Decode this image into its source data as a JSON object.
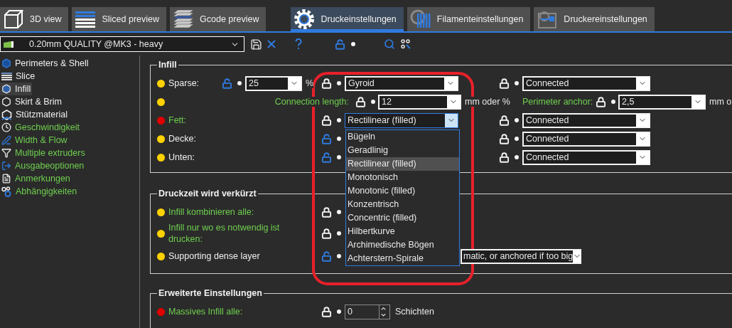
{
  "tabs": [
    {
      "label": "3D view",
      "kind": "view",
      "selected": false
    },
    {
      "label": "Sliced preview",
      "kind": "view",
      "selected": false
    },
    {
      "label": "Gcode preview",
      "kind": "view",
      "selected": false
    },
    {
      "label": "Druckeinstellungen",
      "kind": "settings",
      "selected": true
    },
    {
      "label": "Filamenteinstellungen",
      "kind": "settings",
      "selected": false
    },
    {
      "label": "Druckereinstellungen",
      "kind": "settings",
      "selected": false
    }
  ],
  "preset": {
    "value": "0.20mm QUALITY @MK3 - heavy",
    "locked": false
  },
  "sidebar": [
    {
      "label": "Perimeters & Shell",
      "system_value": false,
      "selected": false
    },
    {
      "label": "Slice",
      "system_value": false,
      "selected": false
    },
    {
      "label": "Infill",
      "system_value": false,
      "selected": true
    },
    {
      "label": "Skirt & Brim",
      "system_value": false,
      "selected": false
    },
    {
      "label": "Stützmaterial",
      "system_value": false,
      "selected": false
    },
    {
      "label": "Geschwindigkeit",
      "system_value": true,
      "selected": false
    },
    {
      "label": "Width & Flow",
      "system_value": true,
      "selected": false
    },
    {
      "label": "Multiple extruders",
      "system_value": true,
      "selected": false
    },
    {
      "label": "Ausgabeoptionen",
      "system_value": true,
      "selected": false
    },
    {
      "label": "Anmerkungen",
      "system_value": true,
      "selected": false
    },
    {
      "label": "Abhängigkeiten",
      "system_value": true,
      "selected": false
    }
  ],
  "infill": {
    "title": "Infill",
    "rows": [
      {
        "kind": "setting",
        "color": "#ffd200",
        "label": "Sparse:",
        "system_value": false,
        "lock_a": {
          "locked": false
        },
        "value_a": "25",
        "unit_a": "%",
        "lock_b": {
          "locked": true
        },
        "value_b": {
          "value": "Gyroid",
          "open": false
        },
        "lock_c": {
          "locked": true
        },
        "value_c": "Connected"
      },
      {
        "kind": "connection",
        "color": "#ffd200",
        "label": "Connection length:",
        "lock": {
          "locked": true
        },
        "value": "12",
        "unit": "mm oder %",
        "label_2": "Perimeter anchor:",
        "lock_2": {
          "locked": true
        },
        "value_2": "2,5",
        "unit_2": "mm o"
      },
      {
        "kind": "setting",
        "color": "#e00000",
        "label": "Fett:",
        "system_value": true,
        "lock_b": {
          "locked": true
        },
        "value_b": {
          "value": "Rectilinear (filled)",
          "open": true
        },
        "lock_c": {
          "locked": true
        },
        "value_c": "Connected"
      },
      {
        "kind": "setting",
        "color": "#ffd200",
        "label": "Decke:",
        "system_value": false,
        "lock_b": {
          "locked": false
        },
        "lock_c": {
          "locked": true
        },
        "value_c": "Connected"
      },
      {
        "kind": "setting",
        "color": "#ffd200",
        "label": "Unten:",
        "system_value": false,
        "lock_b": {
          "locked": false
        },
        "lock_c": {
          "locked": true
        },
        "value_c": "Connected"
      }
    ]
  },
  "dropdown": {
    "items": [
      {
        "label": "Bügeln",
        "selected": false
      },
      {
        "label": "Geradlinig",
        "selected": false
      },
      {
        "label": "Rectilinear (filled)",
        "selected": true
      },
      {
        "label": "Monotonisch",
        "selected": false
      },
      {
        "label": "Monotonic (filled)",
        "selected": false
      },
      {
        "label": "Konzentrisch",
        "selected": false
      },
      {
        "label": "Concentric (filled)",
        "selected": false
      },
      {
        "label": "Hilbertkurve",
        "selected": false
      },
      {
        "label": "Archimedische Bögen",
        "selected": false
      },
      {
        "label": "Achterstern-Spirale",
        "selected": false
      }
    ]
  },
  "reduce_time": {
    "title": "Druckzeit wird verkürzt",
    "rows": [
      {
        "color": "#ffd200",
        "label": "Infill kombinieren alle:",
        "system_value": true,
        "lock": {
          "locked": true
        }
      },
      {
        "color": "#ffd200",
        "label": "Infill nur wo es notwendig ist drucken:",
        "system_value": true,
        "lock": {
          "locked": true
        }
      },
      {
        "color": "#ffd200",
        "label": "Supporting dense layer",
        "system_value": false,
        "lock": {
          "locked": false
        },
        "value": "matic, or anchored if too big"
      }
    ]
  },
  "advanced": {
    "title": "Erweiterte Einstellungen",
    "rows": [
      {
        "color": "#e00000",
        "label": "Massives Infill alle:",
        "system_value": true,
        "lock": {
          "locked": true
        },
        "value": "0",
        "unit": "Schichten"
      }
    ]
  }
}
